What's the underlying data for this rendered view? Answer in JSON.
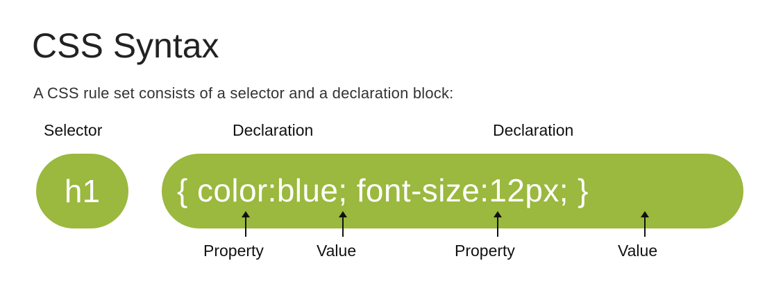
{
  "title": "CSS Syntax",
  "subtitle": "A CSS rule set consists of a selector and a declaration block:",
  "labels": {
    "selector": "Selector",
    "declaration_1": "Declaration",
    "declaration_2": "Declaration",
    "property_1": "Property",
    "value_1": "Value",
    "property_2": "Property",
    "value_2": "Value"
  },
  "selector_text": "h1",
  "declaration_text": "{ color:blue; font-size:12px; }",
  "colors": {
    "pill": "#9bb83f",
    "pill_text": "#ffffff"
  }
}
